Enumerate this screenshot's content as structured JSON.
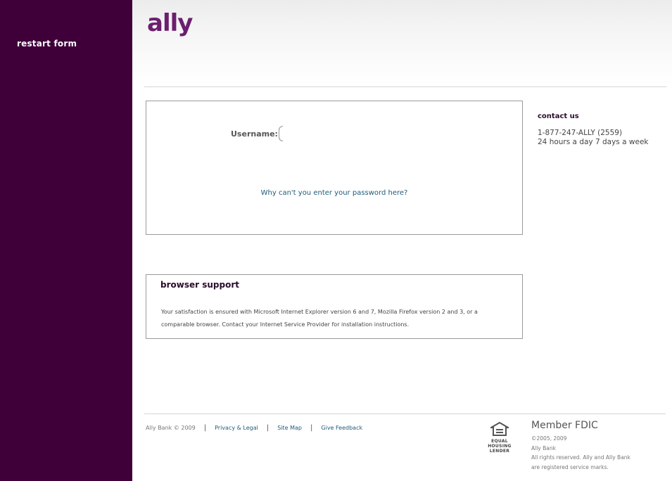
{
  "sidebar": {
    "restart_label": "restart form",
    "bg_color": "#3f0039"
  },
  "header": {
    "logo_text": "ally",
    "logo_color": "#6b1f6f"
  },
  "login": {
    "username_label": "Username:",
    "username_value": "",
    "password_help_link": "Why can't you enter your password here?"
  },
  "contact": {
    "title": "contact us",
    "phone": "1-877-247-ALLY (2559)",
    "hours": "24 hours a day 7 days a week"
  },
  "browser_support": {
    "title": "browser support",
    "text": "Your satisfaction is ensured with Microsoft Internet Explorer version 6 and 7, Mozilla Firefox version 2 and 3, or a comparable browser. Contact your Internet Service Provider for installation instructions."
  },
  "footer": {
    "copyright": "Ally Bank © 2009",
    "links": [
      "Privacy & Legal",
      "Site Map",
      "Give Feedback"
    ],
    "ehl_line1": "EQUAL HOUSING",
    "ehl_line2": "LENDER",
    "fdic_title": "Member FDIC",
    "fdic_copy": "©2005, 2009",
    "fdic_bank": "Ally Bank",
    "fdic_rights1": "All rights reserved. Ally and Ally Bank",
    "fdic_rights2": "are registered service marks."
  }
}
